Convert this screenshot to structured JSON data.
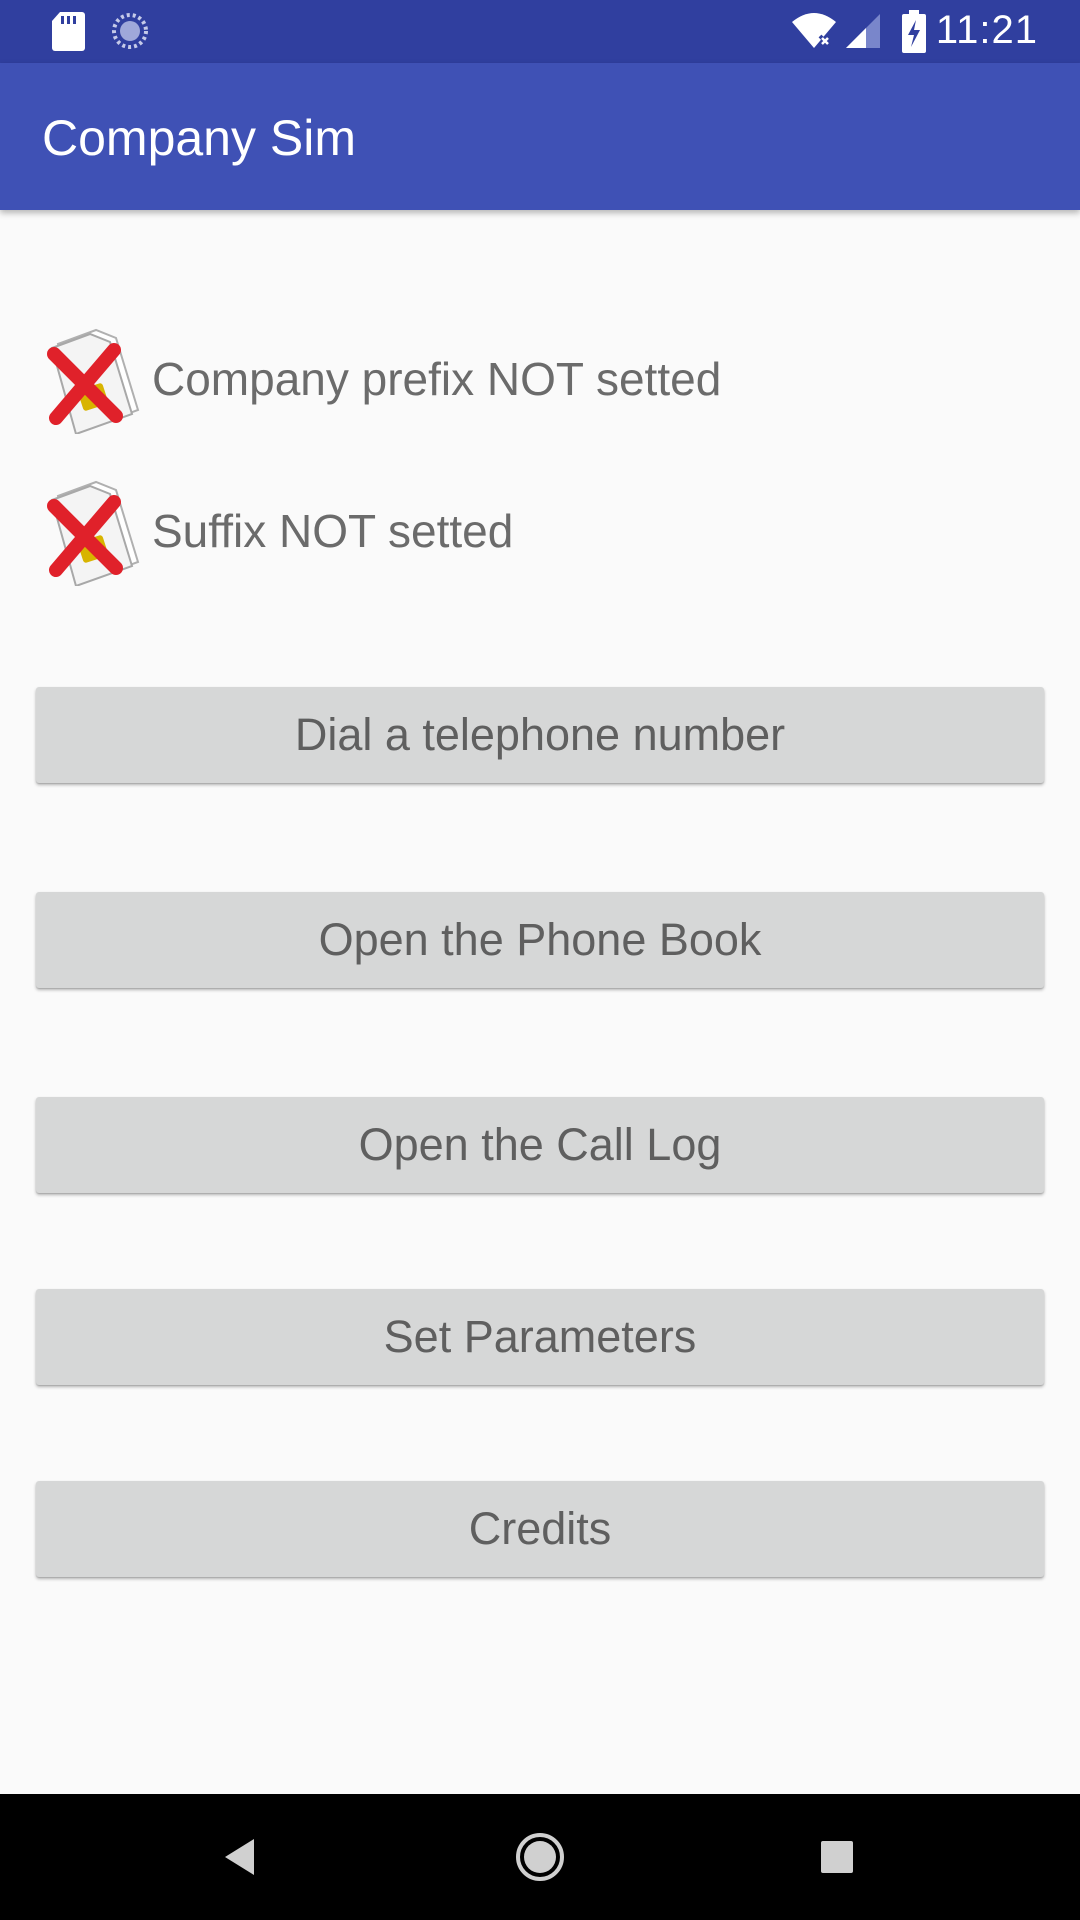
{
  "statusbar": {
    "time": "11:21",
    "icons": [
      "sd-card-icon",
      "sync-icon",
      "wifi-icon",
      "signal-icon",
      "battery-charging-icon"
    ]
  },
  "appbar": {
    "title": "Company Sim"
  },
  "status": [
    {
      "icon": "sim-error-icon",
      "text": "Company prefix NOT setted"
    },
    {
      "icon": "sim-error-icon",
      "text": "Suffix NOT setted"
    }
  ],
  "buttons": {
    "dial": "Dial a telephone number",
    "phonebook": "Open the Phone Book",
    "calllog": "Open the Call Log",
    "parameters": "Set Parameters",
    "credits": "Credits"
  },
  "navbar": {
    "icons": [
      "back-icon",
      "home-icon",
      "recents-icon"
    ]
  },
  "colors": {
    "primary": "#3f51b5",
    "primary_dark": "#303f9f",
    "button": "#d6d7d7",
    "error_cross": "#e0212a"
  }
}
